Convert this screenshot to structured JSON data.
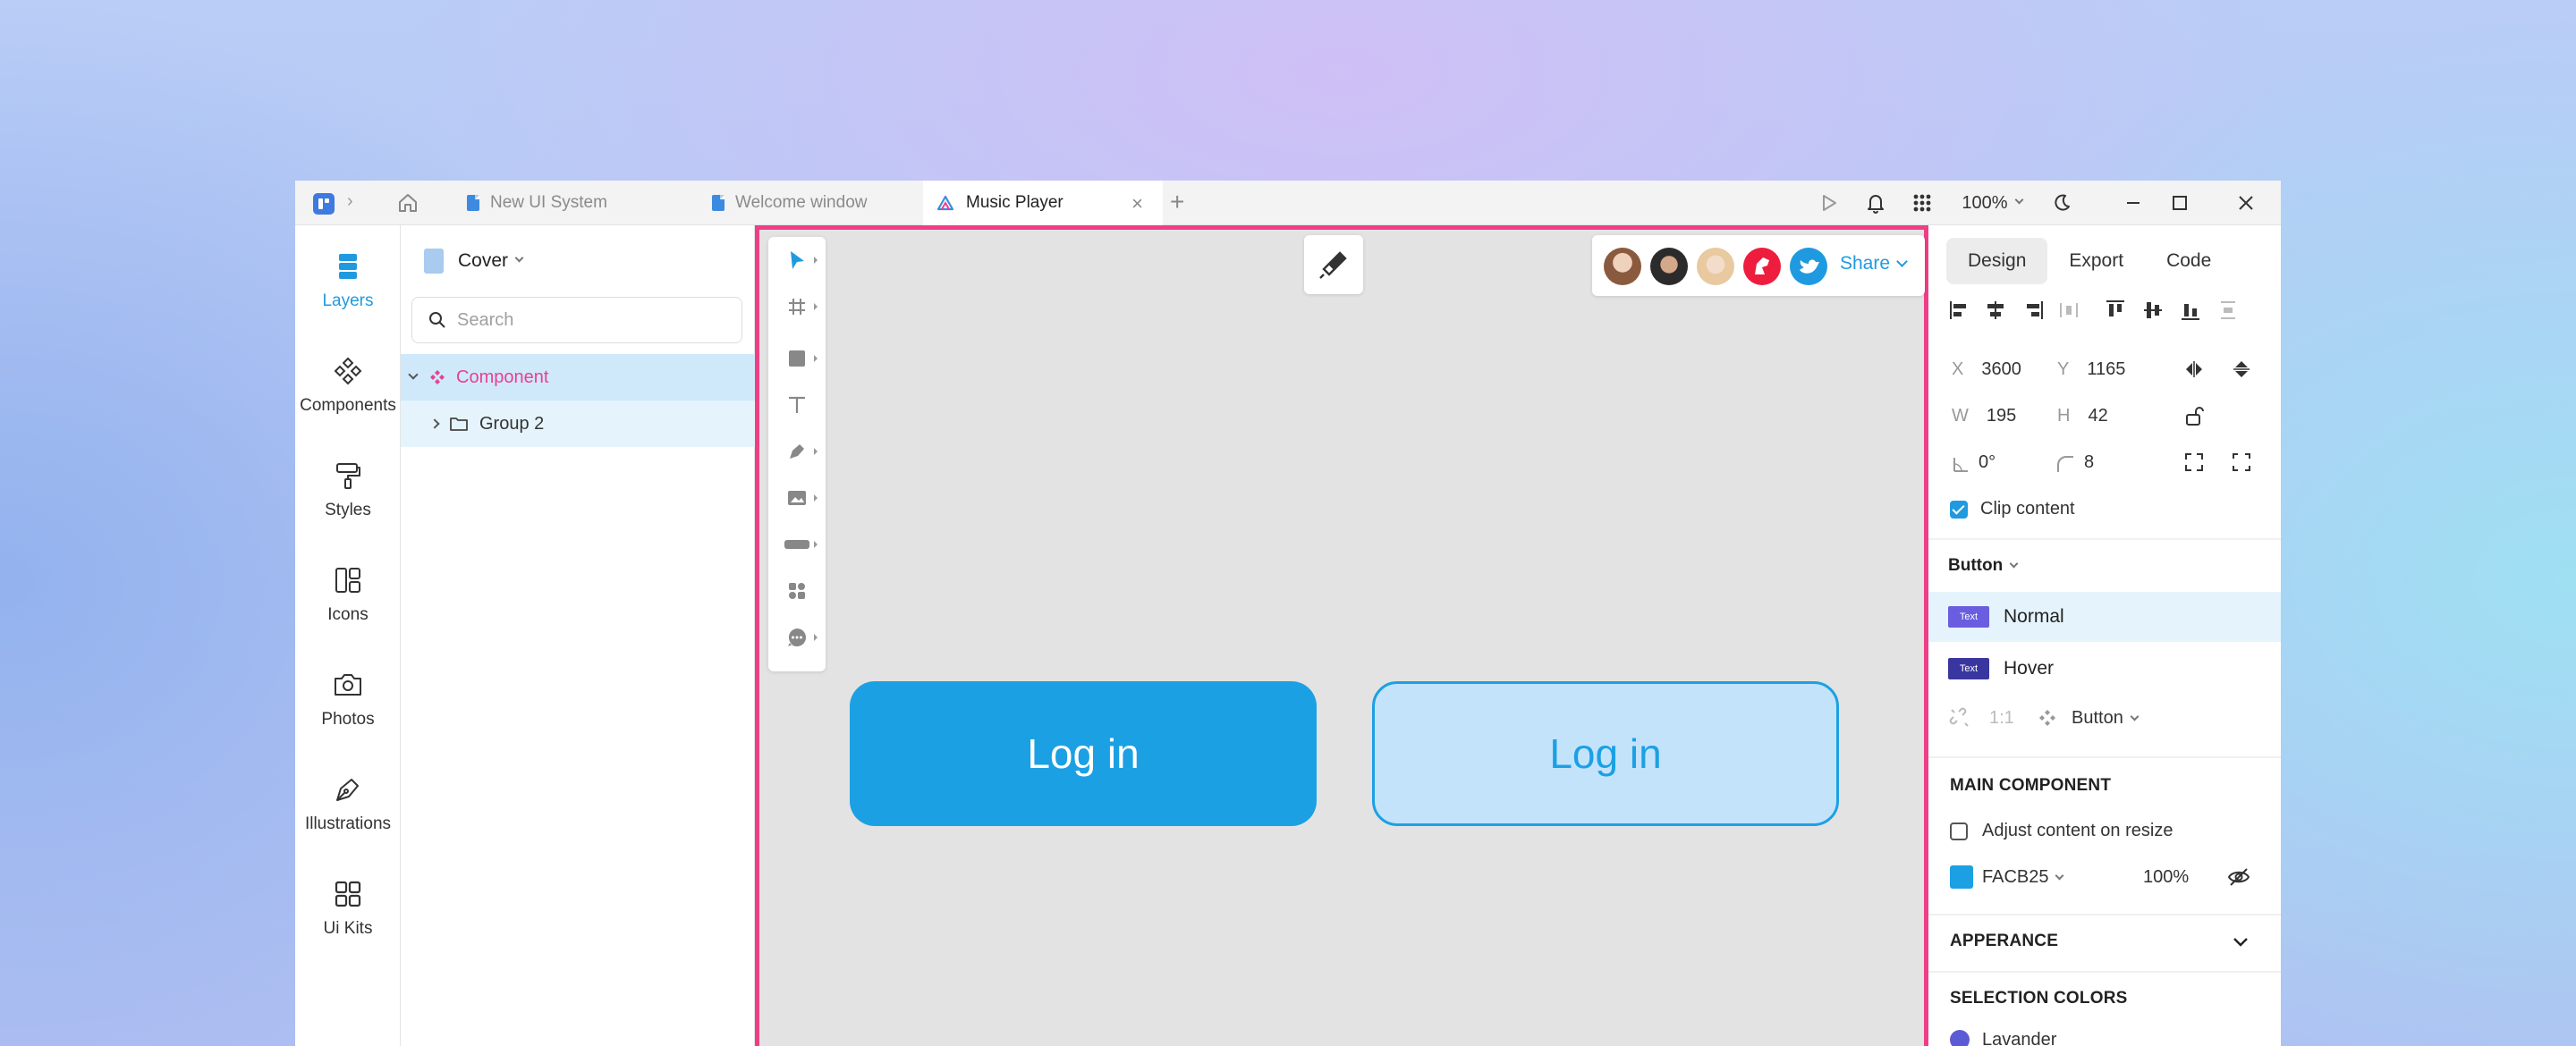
{
  "tabbar": {
    "tabs": [
      {
        "label": "New UI System"
      },
      {
        "label": "Welcome window"
      },
      {
        "label": "Music Player",
        "close": "×"
      }
    ],
    "add_tab": "+",
    "zoom": "100%"
  },
  "rail": {
    "items": [
      {
        "label": "Layers",
        "icon": "layers-icon"
      },
      {
        "label": "Components",
        "icon": "components-icon"
      },
      {
        "label": "Styles",
        "icon": "paint-roller-icon"
      },
      {
        "label": "Icons",
        "icon": "icons-icon"
      },
      {
        "label": "Photos",
        "icon": "camera-icon"
      },
      {
        "label": "Illustrations",
        "icon": "pen-nib-icon"
      },
      {
        "label": "Ui Kits",
        "icon": "grid-icon"
      }
    ]
  },
  "layers": {
    "page": "Cover",
    "search_placeholder": "Search",
    "tree": [
      {
        "label": "Component",
        "type": "component"
      },
      {
        "label": "Group 2",
        "type": "group"
      }
    ]
  },
  "canvas": {
    "share_label": "Share",
    "buttons": [
      {
        "label": "Log in",
        "state": "normal"
      },
      {
        "label": "Log in",
        "state": "hover"
      }
    ]
  },
  "design": {
    "tabs": [
      "Design",
      "Export",
      "Code"
    ],
    "x_label": "X",
    "x_value": "3600",
    "y_label": "Y",
    "y_value": "1165",
    "w_label": "W",
    "w_value": "195",
    "h_label": "H",
    "h_value": "42",
    "rotation_value": "0°",
    "radius_value": "8",
    "clip_content": "Clip content",
    "component_name": "Button",
    "variants": [
      {
        "badge": "Text",
        "name": "Normal",
        "badge_color": "#6b5de0"
      },
      {
        "badge": "Text",
        "name": "Hover",
        "badge_color": "#3a36a0"
      }
    ],
    "ratio": "1:1",
    "instance_name": "Button",
    "main_component_title": "MAIN COMPONENT",
    "adjust_content": "Adjust content on resize",
    "fill_hex": "FACB25",
    "fill_opacity": "100%",
    "appearance_title": "APPERANCE",
    "selection_colors_title": "SELECTION COLORS",
    "selection_color_name": "Lavander"
  },
  "colors": {
    "accent": "#1f9ae0",
    "selection_border": "#ee3f86",
    "button_fill": "#1ca0e4",
    "button_hover_fill": "#c3e3fb",
    "lavander": "#5b5bd6"
  }
}
